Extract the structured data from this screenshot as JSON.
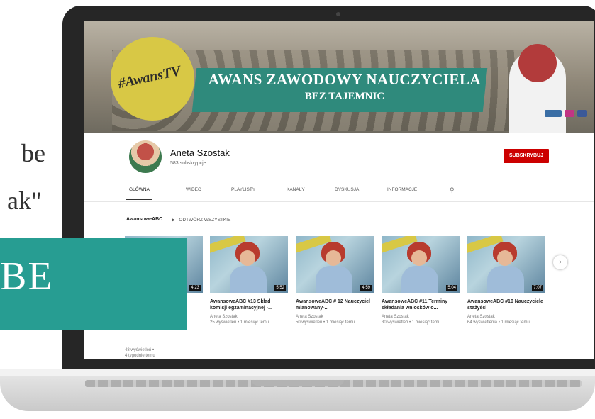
{
  "bg_text": {
    "line1": "be",
    "line2": "ak\""
  },
  "overlay_text": "BE",
  "colors": {
    "teal": "#279d92",
    "subscribe_red": "#cc0000",
    "banner_yellow": "#d8c845"
  },
  "banner": {
    "badge": "#AwansTV",
    "title": "AWANS ZAWODOWY NAUCZYCIELA",
    "subtitle": "BEZ TAJEMNIC",
    "socials": [
      "blog",
      "instagram",
      "facebook"
    ]
  },
  "channel": {
    "name": "Aneta Szostak",
    "subscribers": "583 subskrypcje",
    "subscribe_label": "SUBSKRYBUJ"
  },
  "tabs": [
    "GŁÓWNA",
    "WIDEO",
    "PLAYLISTY",
    "KANAŁY",
    "DYSKUSJA",
    "INFORMACJE"
  ],
  "section": {
    "title": "AwansoweABC",
    "play_all": "ODTWÓRZ WSZYSTKIE"
  },
  "left_card": {
    "line1": "48 wyświetleń •",
    "line2": "4 tygodnie temu"
  },
  "videos": [
    {
      "duration": "4:23",
      "title": "",
      "author": "",
      "meta": ""
    },
    {
      "duration": "5:52",
      "title": "AwansoweABC #13 Skład komisji egzaminacyjnej -...",
      "author": "Aneta Szostak",
      "meta": "25 wyświetleń • 1 miesiąc temu"
    },
    {
      "duration": "4:59",
      "title": "AwansoweABC # 12 Nauczyciel mianowany-...",
      "author": "Aneta Szostak",
      "meta": "50 wyświetleń • 1 miesiąc temu"
    },
    {
      "duration": "5:04",
      "title": "AwansoweABC #11 Terminy składania wniosków o...",
      "author": "Aneta Szostak",
      "meta": "30 wyświetleń • 1 miesiąc temu"
    },
    {
      "duration": "7:07",
      "title": "AwansoweABC #10 Nauczyciele stażyści",
      "author": "Aneta Szostak",
      "meta": "64 wyświetlenia • 1 miesiąc temu"
    }
  ]
}
